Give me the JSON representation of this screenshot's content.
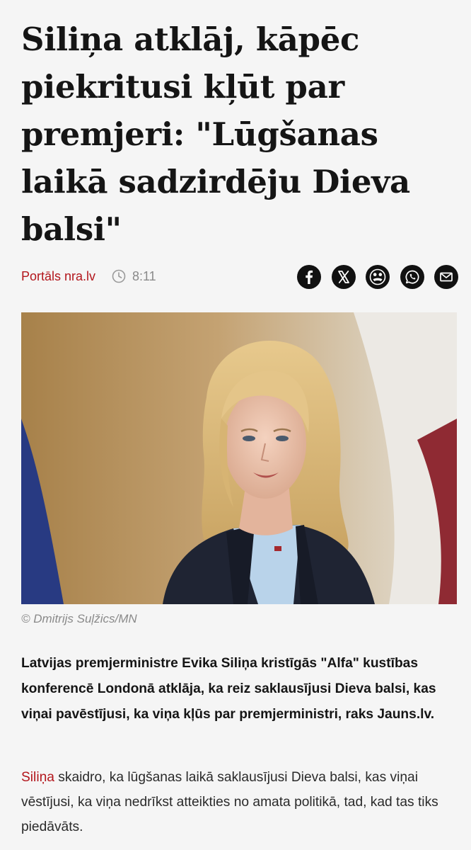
{
  "article": {
    "headline": "Siliņa atklāj, kāpēc piekritusi kļūt par premjeri: \"Lūgšanas laikā sadzirdēju Dieva balsi\"",
    "source": "Portāls nra.lv",
    "time": "8:11",
    "share_icons": [
      "facebook-icon",
      "x-icon",
      "draugiem-icon",
      "whatsapp-icon",
      "email-icon"
    ],
    "photo_credit": "© Dmitrijs Suļžics/MN",
    "lead": "Latvijas premjerministre Evika Siliņa kristīgās \"Alfa\" kustības konferencē Londonā atklāja, ka reiz saklausījusi Dieva balsi, kas viņai pavēstījusi, ka viņa kļūs par premjerministri, raks Jauns.lv.",
    "body_link": "Siliņa",
    "body_rest": " skaidro, ka lūgšanas laikā saklausījusi Dieva balsi, kas viņai vēstījusi, ka viņa nedrīkst atteikties no amata politikā, tad, kad tas tiks piedāvāts."
  },
  "colors": {
    "accent": "#b3161c",
    "text": "#151515",
    "muted": "#8a8a8a",
    "background": "#f5f5f5"
  }
}
